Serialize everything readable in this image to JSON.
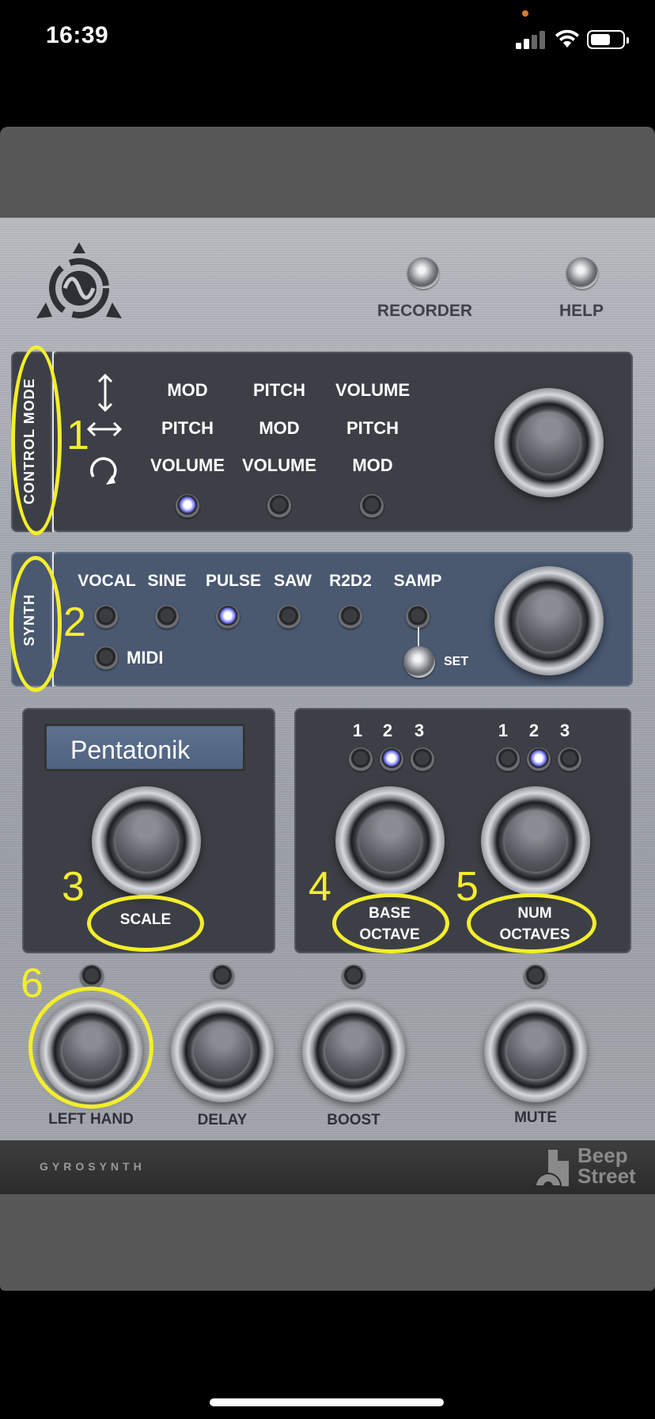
{
  "status_bar": {
    "time": "16:39"
  },
  "app": {
    "footer_title": "GYROSYNTH",
    "brand_line1": "Beep",
    "brand_line2": "Street"
  },
  "top": {
    "recorder_label": "RECORDER",
    "help_label": "HELP"
  },
  "control_mode": {
    "tab_label": "CONTROL MODE",
    "columns": [
      [
        "MOD",
        "PITCH",
        "VOLUME"
      ],
      [
        "PITCH",
        "MOD",
        "VOLUME"
      ],
      [
        "VOLUME",
        "PITCH",
        "MOD"
      ]
    ],
    "selected_index": 0,
    "annotation": "1"
  },
  "synth": {
    "tab_label": "SYNTH",
    "options": [
      "VOCAL",
      "SINE",
      "PULSE",
      "SAW",
      "R2D2",
      "SAMP"
    ],
    "selected_index": 2,
    "midi_label": "MIDI",
    "set_label": "SET",
    "annotation": "2"
  },
  "scale": {
    "display_value": "Pentatonik",
    "label": "SCALE",
    "annotation": "3"
  },
  "base_octave": {
    "options": [
      "1",
      "2",
      "3"
    ],
    "selected_index": 1,
    "label_line1": "BASE",
    "label_line2": "OCTAVE",
    "annotation": "4"
  },
  "num_octaves": {
    "options": [
      "1",
      "2",
      "3"
    ],
    "selected_index": 1,
    "label_line1": "NUM",
    "label_line2": "OCTAVES",
    "annotation": "5"
  },
  "bottom_buttons": [
    {
      "label": "LEFT HAND"
    },
    {
      "label": "DELAY"
    },
    {
      "label": "BOOST"
    },
    {
      "label": "MUTE"
    }
  ],
  "left_hand_annotation": "6",
  "colors": {
    "highlight": "#f3ee2c",
    "led_on": "#6f70ff"
  }
}
